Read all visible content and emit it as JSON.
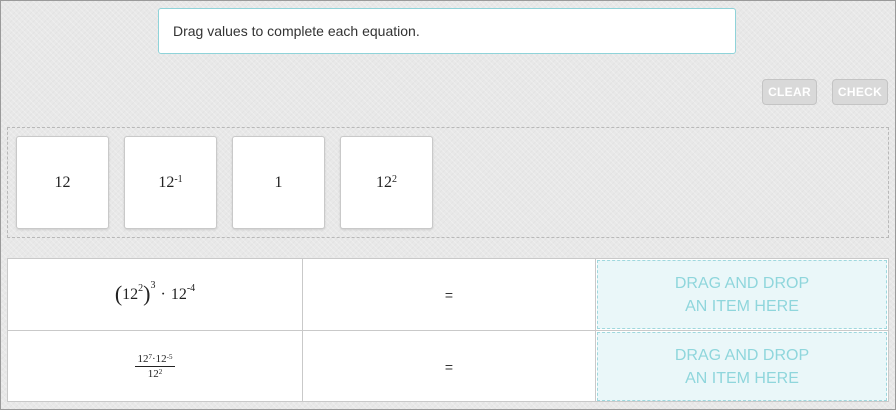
{
  "instructions": "Drag values to complete each equation.",
  "buttons": {
    "clear": "CLEAR",
    "check": "CHECK"
  },
  "tiles": [
    {
      "base": "12",
      "exp": ""
    },
    {
      "base": "12",
      "exp": "-1"
    },
    {
      "base": "1",
      "exp": ""
    },
    {
      "base": "12",
      "exp": "2"
    }
  ],
  "equations": [
    {
      "lparen": "(",
      "base": "12",
      "inner_exp": "2",
      "rparen": ")",
      "outer_exp": "3",
      "dot": "·",
      "base2": "12",
      "exp2": "-4",
      "equals": "="
    },
    {
      "num_base1": "12",
      "num_exp1": "7",
      "num_dot": "·",
      "num_base2": "12",
      "num_exp2": "-5",
      "den_base": "12",
      "den_exp": "2",
      "equals": "="
    }
  ],
  "drop_target": {
    "line1": "DRAG AND DROP",
    "line2": "AN ITEM HERE"
  }
}
